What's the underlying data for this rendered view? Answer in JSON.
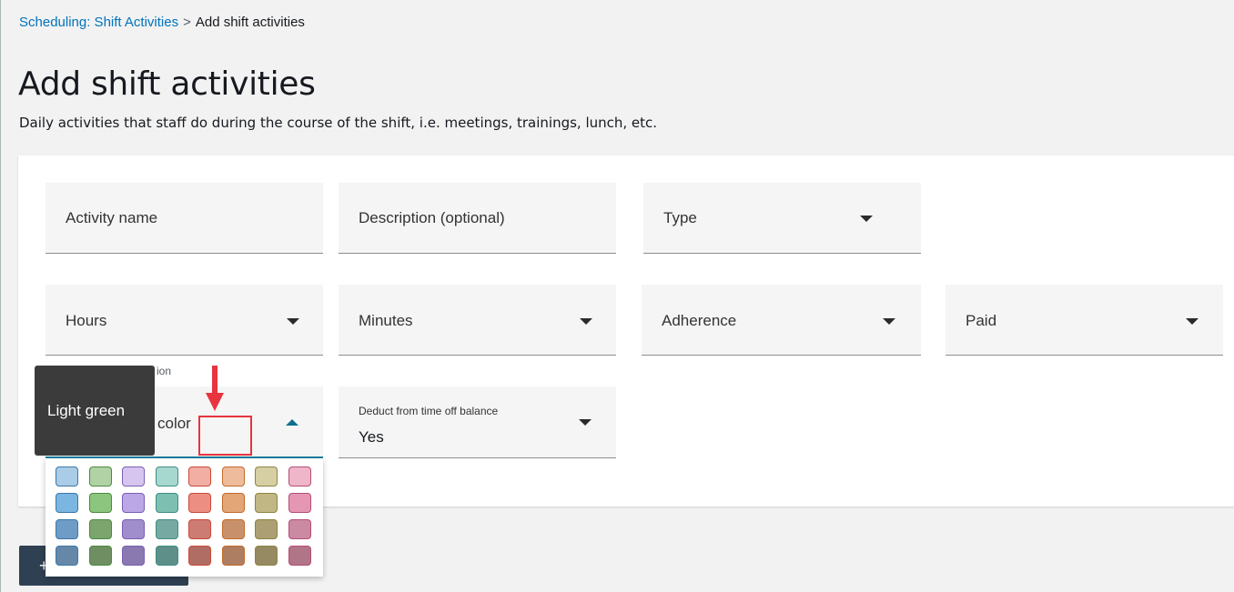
{
  "breadcrumb": {
    "parent": "Scheduling: Shift Activities",
    "separator": ">",
    "current": "Add shift activities"
  },
  "page": {
    "title": "Add shift activities",
    "subtitle": "Daily activities that staff do during the course of the shift, i.e. meetings, trainings, lunch, etc."
  },
  "form": {
    "activity_name": "Activity name",
    "description": "Description (optional)",
    "type": "Type",
    "hours": "Hours",
    "minutes": "Minutes",
    "adherence": "Adherence",
    "paid": "Paid",
    "hours_helper_partial": "ion",
    "color_label_partial": "color",
    "deduct_label": "Deduct from time off balance",
    "deduct_value": "Yes"
  },
  "tooltip": {
    "text": "Light green"
  },
  "palette": {
    "rows": [
      [
        "#a9cde6",
        "#b0d2a4",
        "#d6c6ef",
        "#a6d8cf",
        "#f2aea3",
        "#eebc9c",
        "#d6cfa4",
        "#efb6c9"
      ],
      [
        "#7ab6df",
        "#8cc57e",
        "#bba7e6",
        "#7dc0b2",
        "#ec8f82",
        "#e2a677",
        "#c1b784",
        "#e596b3"
      ],
      [
        "#6e9cc6",
        "#7ca56e",
        "#a08dcb",
        "#76a9a1",
        "#cd7c73",
        "#c9916b",
        "#ab9f73",
        "#ca8aa1"
      ],
      [
        "#6588a8",
        "#6f8e62",
        "#8a79b0",
        "#5e8f89",
        "#b06d64",
        "#ad7e62",
        "#958a62",
        "#b07587"
      ]
    ],
    "borders": [
      "#3b78a8",
      "#4d8a3f",
      "#7a5fb5",
      "#3f8d83",
      "#c94a3c",
      "#c26b2d",
      "#8f8440",
      "#b54d77"
    ]
  },
  "bottom_button": {
    "symbol": "+"
  }
}
